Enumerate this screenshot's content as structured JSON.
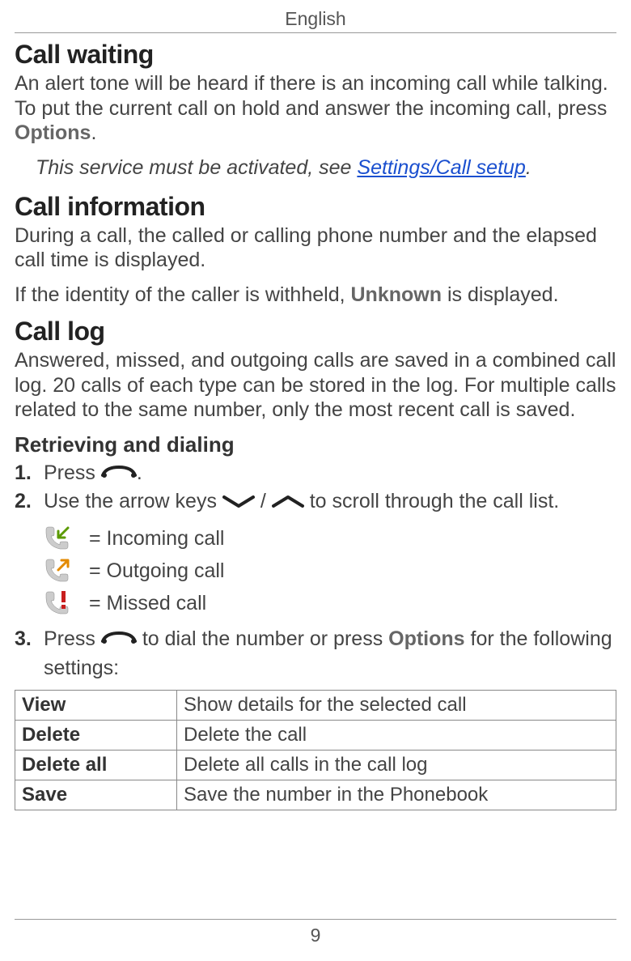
{
  "header": "English",
  "page_number": "9",
  "sections": {
    "call_waiting": {
      "title": "Call waiting",
      "body_pre": "An alert tone will be heard if there is an incoming call while talking. To put the current call on hold and answer the incoming call, press ",
      "body_bold": "Options",
      "body_post": ".",
      "note_pre": "This service must be activated, see ",
      "note_link": "Settings/Call setup",
      "note_post": "."
    },
    "call_info": {
      "title": "Call information",
      "p1": "During a call, the called or calling phone number and the elapsed call time is displayed.",
      "p2_pre": "If the identity of the caller is withheld, ",
      "p2_bold": "Unknown",
      "p2_post": " is displayed."
    },
    "call_log": {
      "title": "Call log",
      "body": "Answered, missed, and outgoing calls are saved in a combined call log. 20 calls of each type can be stored in the log. For multiple calls related to the same number, only the most recent call is saved.",
      "sub": "Retrieving and dialing",
      "steps": {
        "s1_num": "1.",
        "s1_a": "Press ",
        "s1_b": ".",
        "s2_num": "2.",
        "s2_a": "Use the arrow keys ",
        "s2_mid": " / ",
        "s2_b": " to scroll through the call list.",
        "s3_num": "3.",
        "s3_a": "Press ",
        "s3_b": " to dial the number or press ",
        "s3_bold": "Options",
        "s3_c": " for the following settings:"
      },
      "icon_defs": {
        "incoming": "= Incoming call",
        "outgoing": "= Outgoing call",
        "missed": "= Missed call"
      },
      "table": [
        {
          "label": "View",
          "desc": "Show details for the selected call"
        },
        {
          "label": "Delete",
          "desc": "Delete the call"
        },
        {
          "label": "Delete all",
          "desc": "Delete all calls in the call log"
        },
        {
          "label": "Save",
          "desc": "Save the number in the Phonebook"
        }
      ]
    }
  }
}
